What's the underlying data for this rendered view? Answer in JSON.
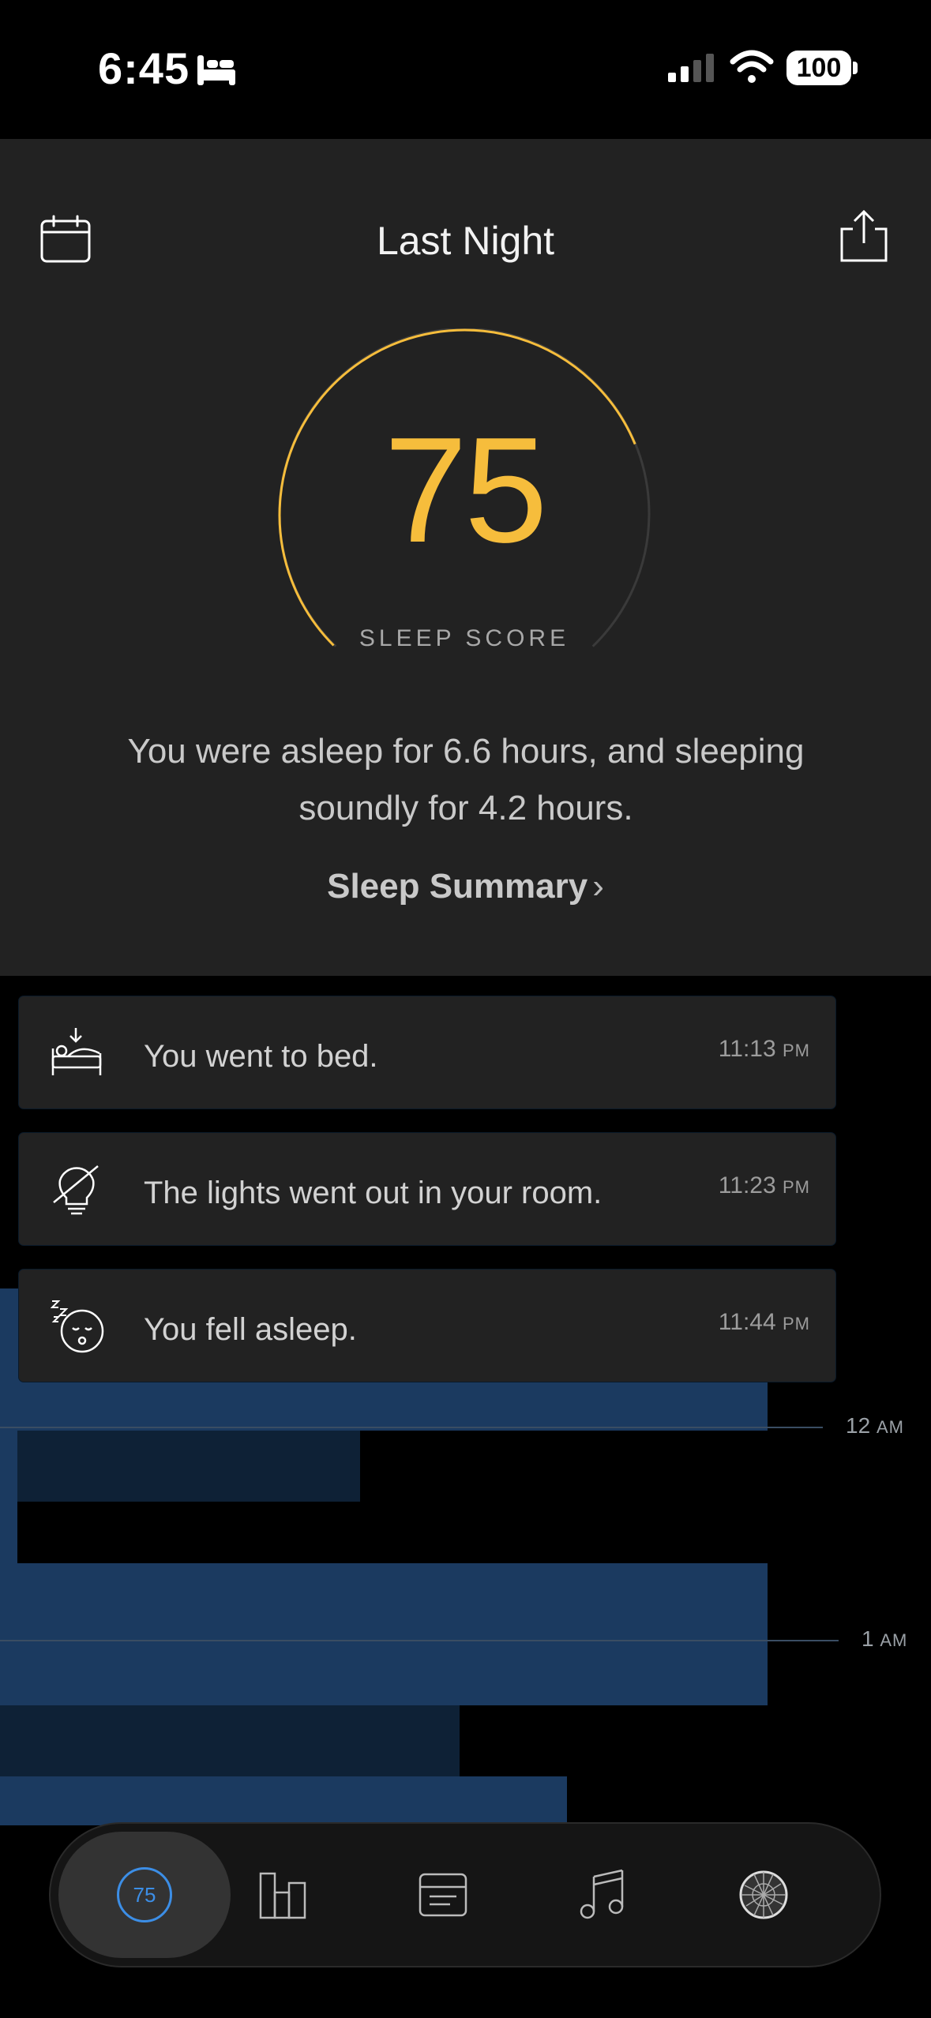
{
  "status_bar": {
    "time": "6:45",
    "battery": "100"
  },
  "header": {
    "title": "Last Night"
  },
  "score": {
    "value": "75",
    "label": "SLEEP SCORE",
    "fraction": 0.75
  },
  "summary": {
    "line1": "You were asleep for 6.6 hours, and sleeping",
    "line2": "soundly for 4.2 hours.",
    "link": "Sleep Summary",
    "link_chevron": "›"
  },
  "events": [
    {
      "icon": "bed-arrow-icon",
      "text": "You went to bed.",
      "time": "11:13",
      "ampm": "PM"
    },
    {
      "icon": "lights-off-icon",
      "text": "The lights went out in your room.",
      "time": "11:23",
      "ampm": "PM"
    },
    {
      "icon": "asleep-face-icon",
      "text": "You fell asleep.",
      "time": "11:44",
      "ampm": "PM"
    }
  ],
  "chart_labels": [
    {
      "hour": "12",
      "ampm": "AM"
    },
    {
      "hour": "1",
      "ampm": "AM"
    }
  ],
  "tabs": [
    {
      "name": "tab-score",
      "badge": "75"
    },
    {
      "name": "tab-trends"
    },
    {
      "name": "tab-journal"
    },
    {
      "name": "tab-sounds"
    },
    {
      "name": "tab-profile"
    }
  ],
  "colors": {
    "score_accent": "#f6bd3c",
    "tab_accent": "#3c8ee6",
    "deep_sleep": "#1b3a60",
    "light_sleep": "#0e2136"
  }
}
